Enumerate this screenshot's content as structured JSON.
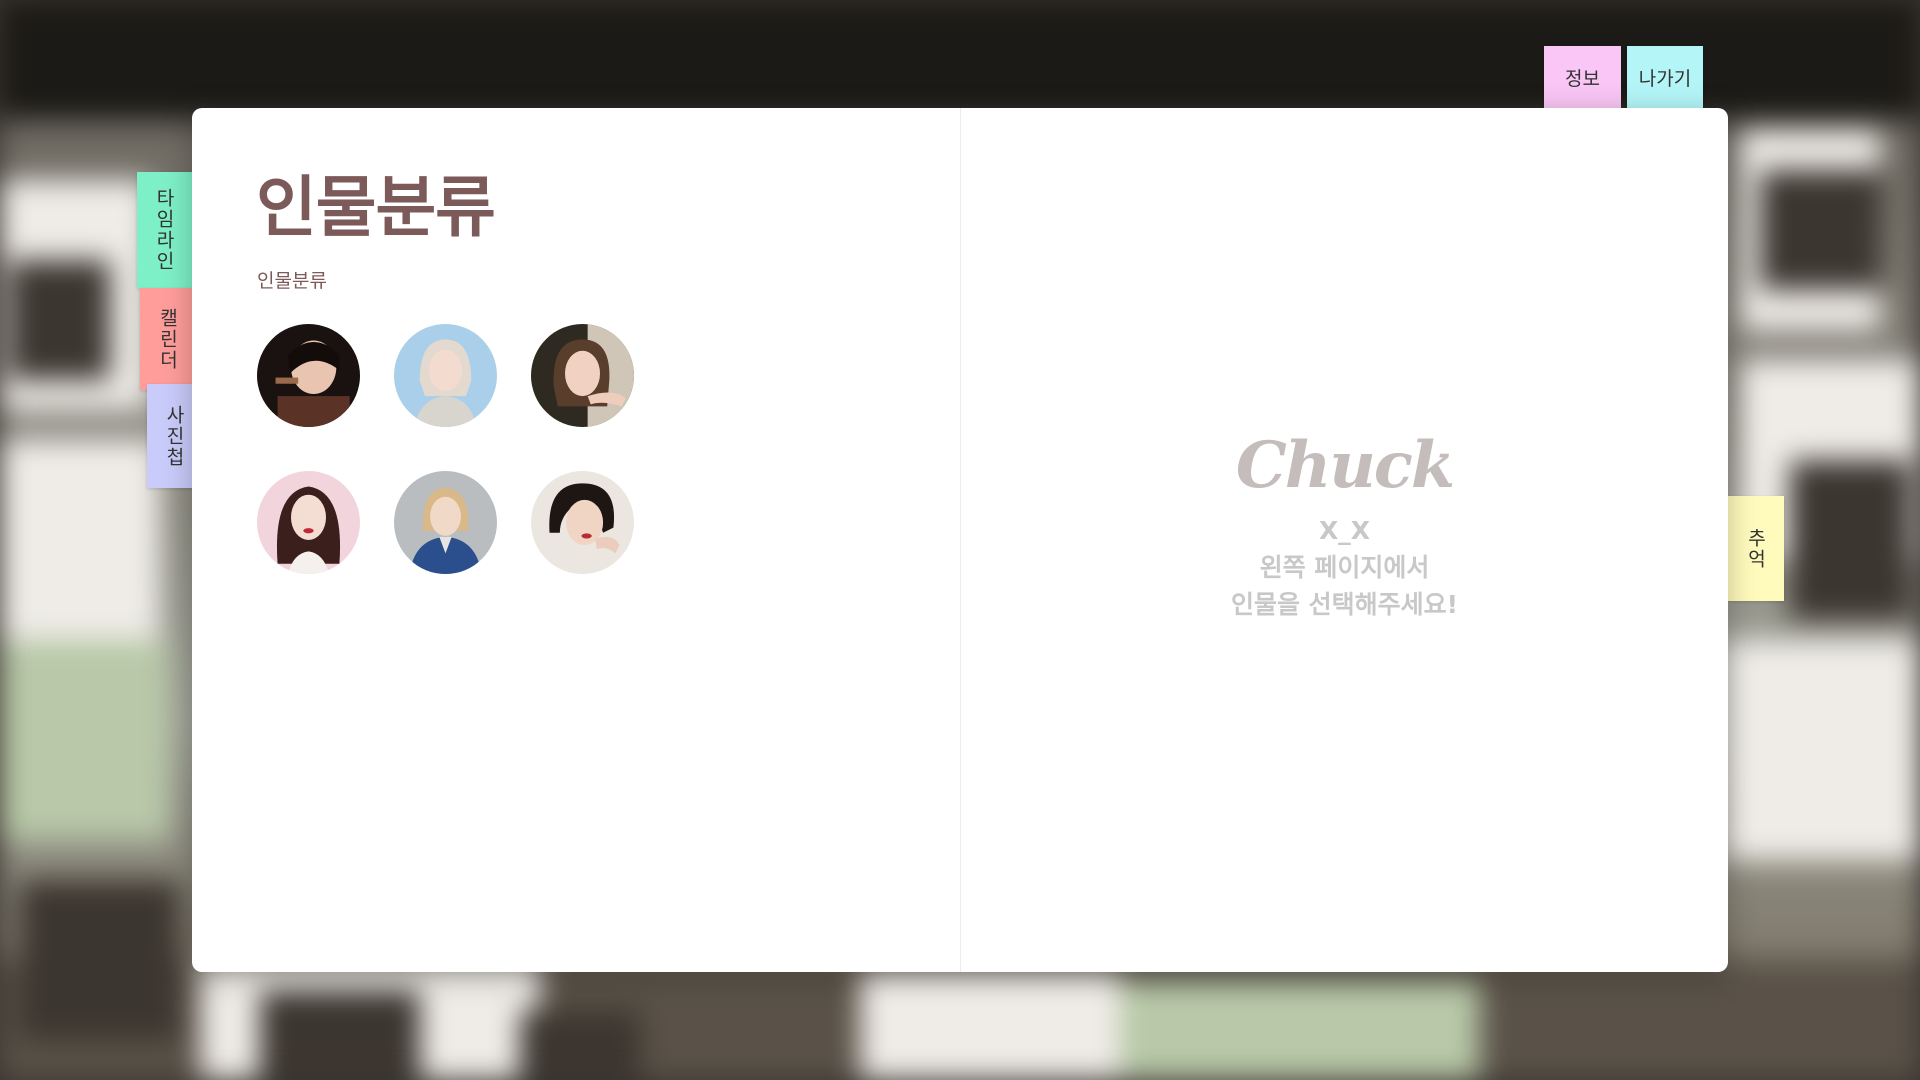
{
  "tabs": {
    "timeline": "타임라인",
    "calendar": "캘린더",
    "album": "사진첩",
    "info": "정보",
    "exit": "나가기",
    "memory": "추억"
  },
  "left_page": {
    "title": "인물분류",
    "section_label": "인물분류",
    "people": [
      {
        "id": "person-1"
      },
      {
        "id": "person-2"
      },
      {
        "id": "person-3"
      },
      {
        "id": "person-4"
      },
      {
        "id": "person-5"
      },
      {
        "id": "person-6"
      }
    ]
  },
  "right_page": {
    "brand": "Chuck",
    "emoticon": "X_X",
    "message_line1": "왼쪽 페이지에서",
    "message_line2": "인물을 선택해주세요!"
  },
  "colors": {
    "title": "#7d5a5a",
    "brand": "#c5bcbc",
    "tab_timeline": "#7ef0c8",
    "tab_calendar": "#ff9d9b",
    "tab_album": "#c9ccfa",
    "tab_info": "#f9c6f5",
    "tab_exit": "#b4f6f8",
    "tab_memory": "#fffbbd"
  }
}
